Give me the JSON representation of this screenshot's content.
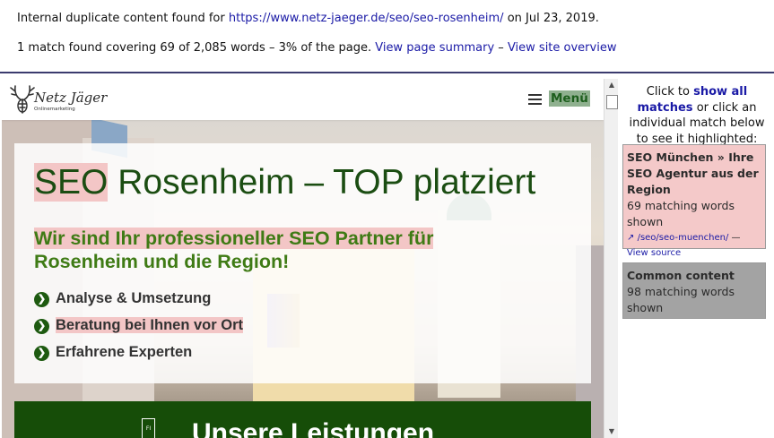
{
  "header": {
    "line1_prefix": "Internal duplicate content found for",
    "url": "https://www.netz-jaeger.de/seo/seo-rosenheim/",
    "line1_suffix": "on Jul 23, 2019.",
    "line2_text": "1 match found covering 69 of 2,085 words – 3% of the page.",
    "view_page_summary": "View page summary",
    "dash": "–",
    "view_site_overview": "View site overview"
  },
  "preview": {
    "nav": {
      "logo_text": "Netz Jäger",
      "logo_sub": "Onlinemarketing",
      "menu_label": "Menü"
    },
    "hero": {
      "title_highlight": "SEO",
      "title_rest": "Rosenheim – TOP platziert",
      "subtitle_highlight": "Wir sind Ihr professioneller SEO Partner für",
      "subtitle_rest": "Rosenheim und die Region!",
      "bullets": [
        "Analyse & Umsetzung",
        "Beratung bei Ihnen vor Ort",
        "Erfahrene Experten"
      ]
    },
    "services": {
      "title": "Unsere Leistungen",
      "icon_text": "FI"
    }
  },
  "sidebar": {
    "instructions_prefix": "Click to",
    "show_all_matches": "show all matches",
    "instructions_suffix": "or click an individual match below to see it highlighted:",
    "matches": [
      {
        "title": "SEO München » Ihre SEO Agentur aus der Region",
        "count": "69 matching words shown",
        "path": "/seo/seo-muenchen/",
        "separator": "—",
        "view_source": "View source",
        "color": "#f4c9c9"
      },
      {
        "title": "Common content",
        "count": "98 matching words shown",
        "color": "#a3a3a3"
      }
    ]
  },
  "colors": {
    "link": "#1a1aa6",
    "highlight": "#f3c6c6",
    "brand_green": "#164d08",
    "subtitle_green": "#3f7b15"
  },
  "icons": [
    "hamburger-icon",
    "chevron-right-icon",
    "external-link-icon",
    "scroll-up-icon",
    "scroll-down-icon"
  ]
}
